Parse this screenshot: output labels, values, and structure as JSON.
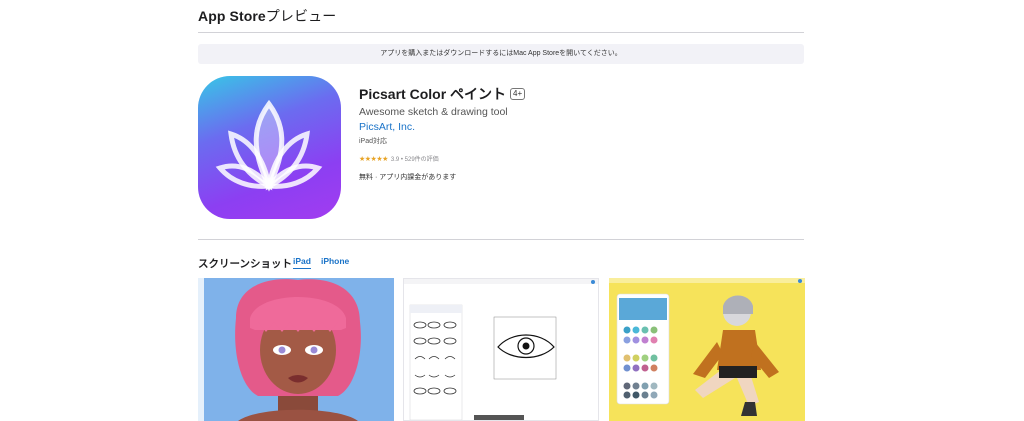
{
  "header": {
    "title_bold": "App Store",
    "title_rest": "プレビュー"
  },
  "banner": {
    "text": "アプリを購入またはダウンロードするにはMac App Storeを開いてください。"
  },
  "app": {
    "name": "Picsart Color ペイント",
    "age_rating": "4+",
    "subtitle": "Awesome sketch & drawing tool",
    "developer": "PicsArt, Inc.",
    "device_support": "iPad対応",
    "stars": "★★★★★",
    "rating_text": "3.9 • 529件の評価",
    "price": "無料 · アプリ内課金があります"
  },
  "screenshots": {
    "heading": "スクリーンショット",
    "tabs": [
      {
        "label": "iPad",
        "active": true
      },
      {
        "label": "iPhone",
        "active": false
      }
    ]
  },
  "colors": {
    "link": "#1a73c8",
    "icon_gradient": [
      "#37c7e6",
      "#8c3ff2"
    ],
    "shot1_bg": "#79aee8",
    "shot3_bg": "#f7e55a"
  }
}
